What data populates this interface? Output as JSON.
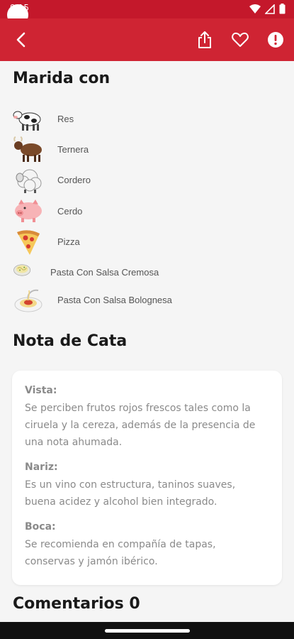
{
  "status": {
    "time": "9:15"
  },
  "colors": {
    "app_bar": "#cf2433",
    "status_bar": "#c4182b"
  },
  "header": {
    "back_icon": "chevron-left-icon",
    "share_icon": "share-icon",
    "favorite_icon": "heart-icon",
    "report_icon": "alert-icon"
  },
  "pairing": {
    "title": "Marida con",
    "items": [
      {
        "label": "Res",
        "icon": "cow-icon"
      },
      {
        "label": "Ternera",
        "icon": "ox-icon"
      },
      {
        "label": "Cordero",
        "icon": "sheep-icon"
      },
      {
        "label": "Cerdo",
        "icon": "pig-icon"
      },
      {
        "label": "Pizza",
        "icon": "pizza-icon"
      },
      {
        "label": "Pasta Con Salsa Cremosa",
        "icon": "pasta-cream-icon"
      },
      {
        "label": "Pasta Con Salsa Bolognesa",
        "icon": "pasta-bolognese-icon"
      }
    ]
  },
  "tasting": {
    "title": "Nota de Cata",
    "notes": [
      {
        "head": "Vista:",
        "lines": [
          "Se perciben frutos rojos frescos tales como la",
          "ciruela y la cereza, además de la presencia de",
          "una nota ahumada."
        ]
      },
      {
        "head": "Nariz:",
        "lines": [
          "Es un vino con estructura, taninos suaves,",
          "buena acidez y alcohol bien integrado."
        ]
      },
      {
        "head": "Boca:",
        "lines": [
          "Se recomienda en compañía de tapas,",
          "conservas y jamón ibérico."
        ]
      }
    ]
  },
  "comments": {
    "title": "Comentarios 0"
  }
}
